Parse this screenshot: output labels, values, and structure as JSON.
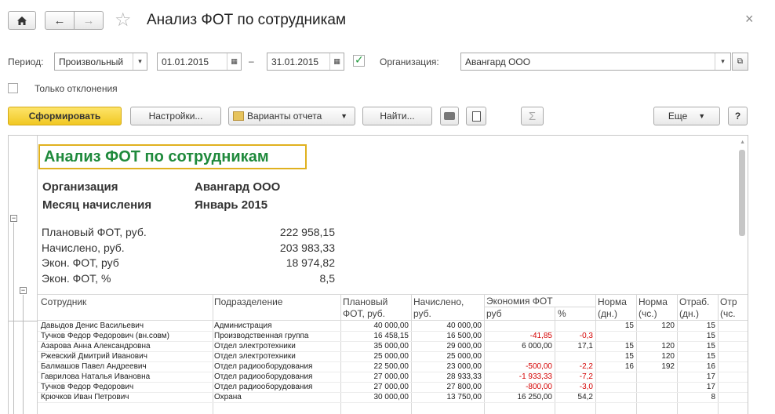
{
  "window": {
    "title": "Анализ ФОТ по сотрудникам",
    "close_glyph": "×"
  },
  "filters": {
    "period_label": "Период:",
    "period_type": "Произвольный",
    "date_from": "01.01.2015",
    "dash": "–",
    "date_to": "31.01.2015",
    "org_label": "Организация:",
    "org_value": "Авангард ООО",
    "only_deviations": "Только отклонения"
  },
  "toolbar": {
    "generate": "Сформировать",
    "settings": "Настройки...",
    "variants": "Варианты отчета",
    "find": "Найти...",
    "sigma": "Σ",
    "more": "Еще",
    "help": "?"
  },
  "report": {
    "title": "Анализ ФОТ по сотрудникам",
    "org_label": "Организация",
    "org_value": "Авангард ООО",
    "month_label": "Месяц начисления",
    "month_value": "Январь 2015",
    "summary": [
      {
        "label": "Плановый ФОТ, руб.",
        "value": "222 958,15"
      },
      {
        "label": "Начислено, руб.",
        "value": "203 983,33"
      },
      {
        "label": "Экон. ФОТ, руб",
        "value": "18 974,82"
      },
      {
        "label": "Экон. ФОТ, %",
        "value": "8,5"
      }
    ],
    "headers": {
      "employee": "Сотрудник",
      "department": "Подразделение",
      "plan_1": "Плановый",
      "plan_2": "ФОТ, руб.",
      "accrued_1": "Начислено,",
      "accrued_2": "руб.",
      "economy": "Экономия ФОТ",
      "economy_rub": "руб",
      "economy_pct": "%",
      "norm_days_1": "Норма",
      "norm_days_2": "(дн.)",
      "norm_hours_1": "Норма",
      "norm_hours_2": "(чс.)",
      "worked_days_1": "Отраб.",
      "worked_days_2": "(дн.)",
      "worked_hours_1": "Отр",
      "worked_hours_2": "(чс."
    },
    "rows": [
      {
        "name": "Давыдов Денис Васильевич",
        "dept": "Администрация",
        "plan": "40 000,00",
        "accrued": "40 000,00",
        "eco_rub": "",
        "eco_pct": "",
        "norm_d": "15",
        "norm_h": "120",
        "work_d": "15",
        "neg": false
      },
      {
        "name": "Тучков Федор Федорович (вн.совм)",
        "dept": "Производственная группа",
        "plan": "16 458,15",
        "accrued": "16 500,00",
        "eco_rub": "-41,85",
        "eco_pct": "-0,3",
        "norm_d": "",
        "norm_h": "",
        "work_d": "15",
        "neg": true
      },
      {
        "name": "Азарова Анна Александровна",
        "dept": "Отдел электротехники",
        "plan": "35 000,00",
        "accrued": "29 000,00",
        "eco_rub": "6 000,00",
        "eco_pct": "17,1",
        "norm_d": "15",
        "norm_h": "120",
        "work_d": "15",
        "neg": false
      },
      {
        "name": "Ржевский Дмитрий Иванович",
        "dept": "Отдел электротехники",
        "plan": "25 000,00",
        "accrued": "25 000,00",
        "eco_rub": "",
        "eco_pct": "",
        "norm_d": "15",
        "norm_h": "120",
        "work_d": "15",
        "neg": false
      },
      {
        "name": "Балмашов Павел Андреевич",
        "dept": "Отдел радиооборудования",
        "plan": "22 500,00",
        "accrued": "23 000,00",
        "eco_rub": "-500,00",
        "eco_pct": "-2,2",
        "norm_d": "16",
        "norm_h": "192",
        "work_d": "16",
        "neg": true
      },
      {
        "name": "Гаврилова Наталья Ивановна",
        "dept": "Отдел радиооборудования",
        "plan": "27 000,00",
        "accrued": "28 933,33",
        "eco_rub": "-1 933,33",
        "eco_pct": "-7,2",
        "norm_d": "",
        "norm_h": "",
        "work_d": "17",
        "neg": true
      },
      {
        "name": "Тучков Федор Федорович",
        "dept": "Отдел радиооборудования",
        "plan": "27 000,00",
        "accrued": "27 800,00",
        "eco_rub": "-800,00",
        "eco_pct": "-3,0",
        "norm_d": "",
        "norm_h": "",
        "work_d": "17",
        "neg": true
      },
      {
        "name": "Крючков Иван Петрович",
        "dept": "Охрана",
        "plan": "30 000,00",
        "accrued": "13 750,00",
        "eco_rub": "16 250,00",
        "eco_pct": "54,2",
        "norm_d": "",
        "norm_h": "",
        "work_d": "8",
        "neg": false
      }
    ]
  },
  "colors": {
    "accent_yellow": "#f5d238",
    "title_green": "#1f8a3c",
    "negative_red": "#d40000",
    "title_border": "#e0b11f"
  }
}
